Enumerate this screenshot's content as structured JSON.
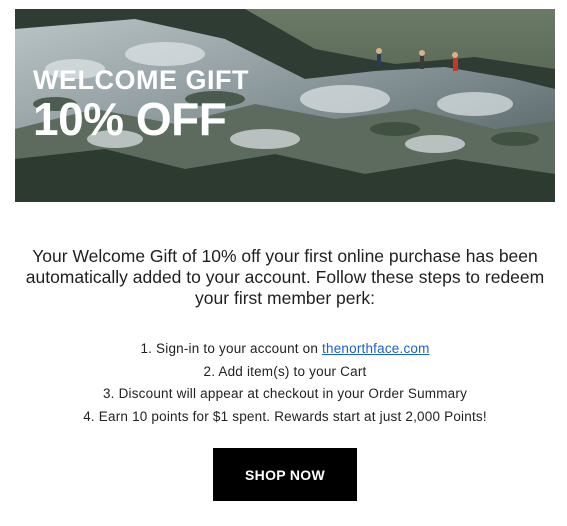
{
  "hero": {
    "headline": "WELCOME GIFT",
    "offer": "10% OFF"
  },
  "intro": {
    "text": "Your Welcome Gift of 10% off your first online purchase has been automatically added to your account. Follow these steps to redeem your first member perk:"
  },
  "steps": [
    {
      "prefix": "1. Sign-in to your account on ",
      "link": "thenorthface.com"
    },
    {
      "text": "2. Add item(s) to your Cart"
    },
    {
      "text": "3. Discount will appear at checkout in your Order Summary"
    },
    {
      "text": "4. Earn 10 points for $1 spent. Rewards start at just 2,000 Points!"
    }
  ],
  "cta": {
    "label": "SHOP NOW"
  },
  "colors": {
    "link": "#1a5fd6",
    "button_bg": "#000000",
    "button_text": "#ffffff"
  }
}
